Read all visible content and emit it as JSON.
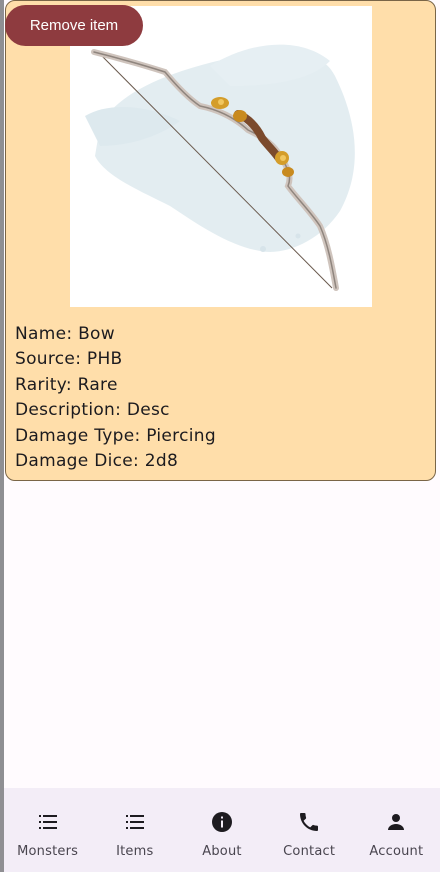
{
  "item": {
    "remove_label": "Remove item",
    "image_icon": "bow-illustration",
    "details": [
      {
        "label": "Name",
        "value": "Bow"
      },
      {
        "label": "Source",
        "value": "PHB"
      },
      {
        "label": "Rarity",
        "value": "Rare"
      },
      {
        "label": "Description",
        "value": "Desc"
      },
      {
        "label": "Damage Type",
        "value": "Piercing"
      },
      {
        "label": "Damage Dice",
        "value": "2d8"
      }
    ],
    "lines": [
      "Name: Bow",
      "Source: PHB",
      "Rarity: Rare",
      "Description: Desc",
      "Damage Type: Piercing",
      "Damage Dice: 2d8"
    ]
  },
  "nav": [
    {
      "label": "Monsters",
      "icon": "list-icon"
    },
    {
      "label": "Items",
      "icon": "list-icon"
    },
    {
      "label": "About",
      "icon": "info-icon"
    },
    {
      "label": "Contact",
      "icon": "phone-icon"
    },
    {
      "label": "Account",
      "icon": "person-icon"
    }
  ],
  "colors": {
    "card_bg": "#ffdeaa",
    "card_border": "#7a6547",
    "remove_button": "#8e3b3f",
    "nav_bg": "#f3edf7",
    "nav_text": "#49454f",
    "page_bg": "#fffbfe"
  }
}
